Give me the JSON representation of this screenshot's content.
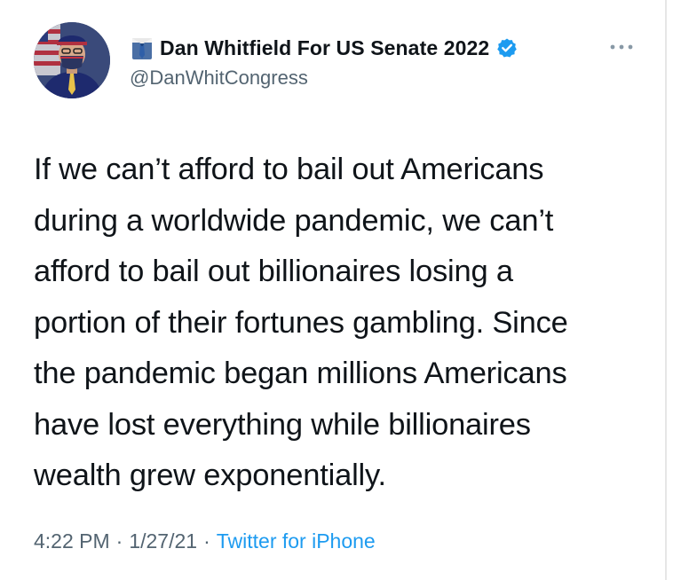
{
  "author": {
    "display_name": "Dan Whitfield For US Senate 2022",
    "handle": "@DanWhitCongress",
    "name_emoji": "necktie-icon",
    "verified": true
  },
  "tweet": {
    "text": "If we can’t afford to bail out Americans\nduring a worldwide pandemic, we can’t\nafford to bail out billionaires losing a\nportion of their fortunes gambling. Since\nthe pandemic began millions Americans\nhave lost everything while billionaires\nwealth grew exponentially."
  },
  "meta": {
    "time": "4:22 PM",
    "separator": "·",
    "date": "1/27/21",
    "source": "Twitter for iPhone"
  },
  "colors": {
    "text": "#0f1419",
    "secondary": "#536471",
    "link": "#1d9bf0",
    "verified": "#1d9bf0"
  }
}
